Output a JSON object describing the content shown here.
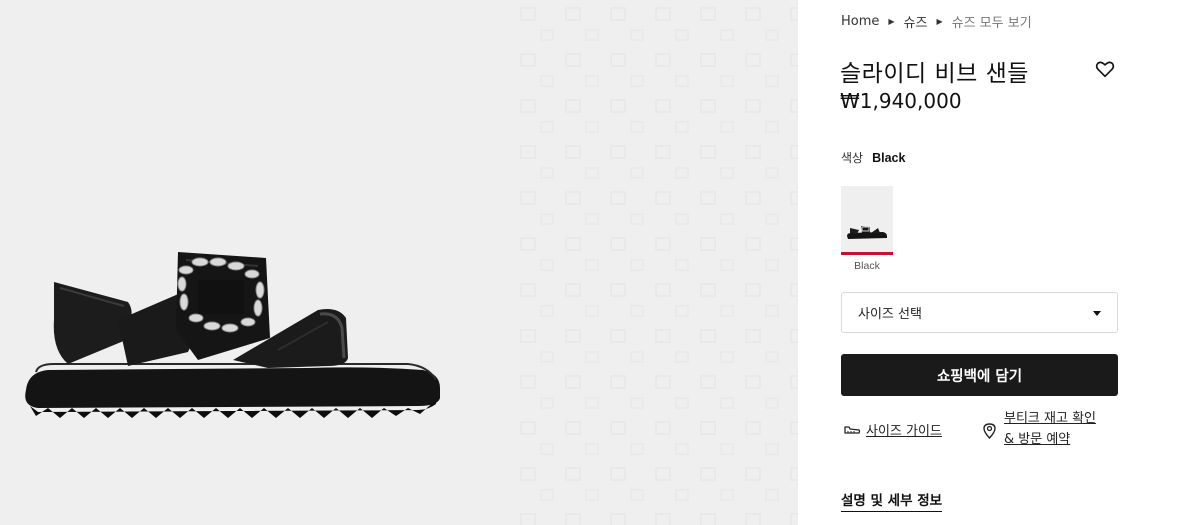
{
  "breadcrumb": {
    "items": [
      "Home",
      "슈즈",
      "슈즈 모두 보기"
    ]
  },
  "product": {
    "title": "슬라이디 비브 샌들",
    "price": "₩1,940,000"
  },
  "color": {
    "label": "색상",
    "selected": "Black",
    "swatches": [
      {
        "caption": "Black",
        "underline_color": "#c8102e"
      }
    ]
  },
  "size_select": {
    "placeholder": "사이즈 선택"
  },
  "actions": {
    "add_to_bag": "쇼핑백에 담기",
    "size_guide": "사이즈 가이드",
    "store_stock_line1": "부티크 재고 확인",
    "store_stock_line2": "& 방문 예약"
  },
  "details": {
    "label": "설명 및 세부 정보"
  },
  "icons": {
    "wishlist": "heart-icon",
    "breadcrumb_separator": "triangle-right-icon",
    "select_caret": "caret-down-icon",
    "size_guide": "ruler-shoe-icon",
    "store": "location-pin-icon"
  },
  "colors": {
    "gallery_bg": "#efefef",
    "button_bg": "#1a1a1a",
    "accent": "#c8102e"
  }
}
